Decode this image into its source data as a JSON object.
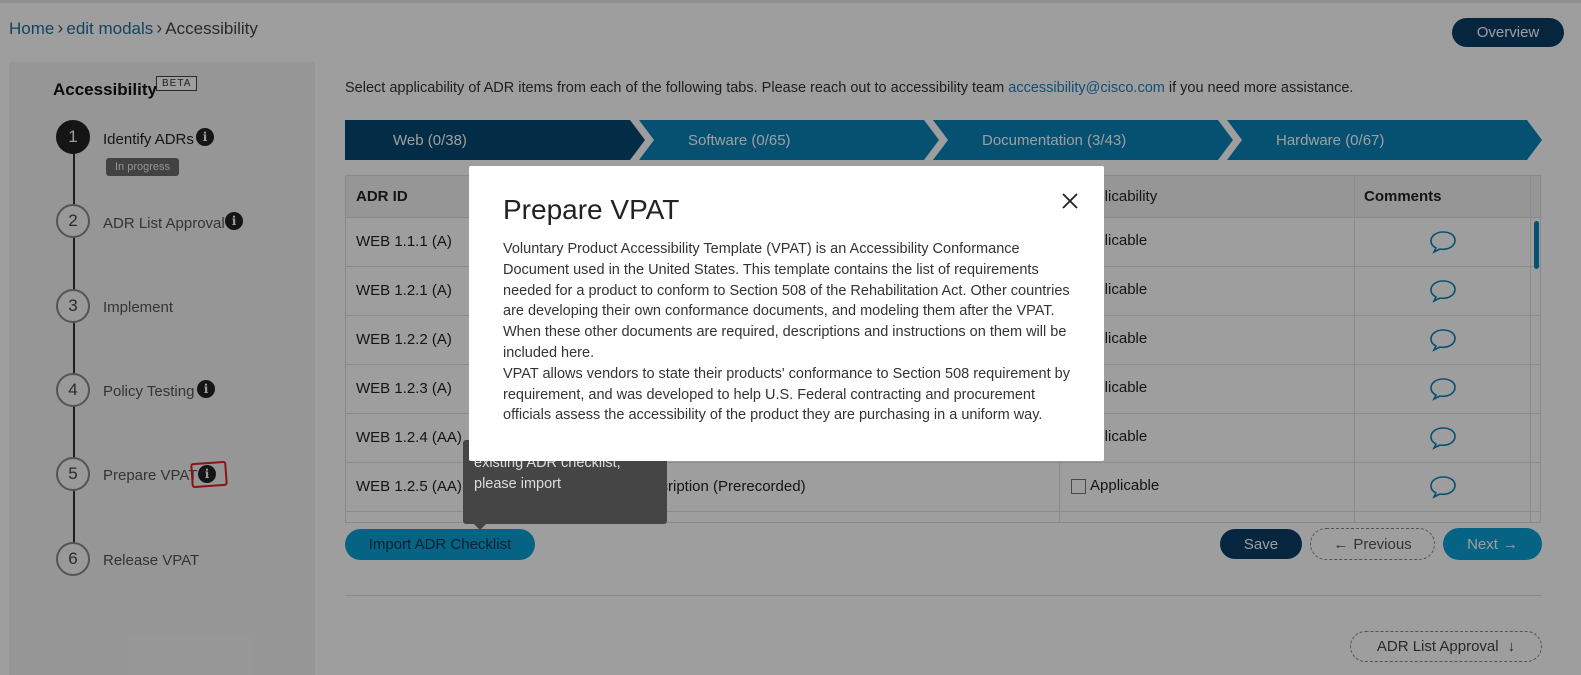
{
  "breadcrumb": {
    "home": "Home",
    "edit_modals": "edit modals",
    "current": "Accessibility",
    "separator": ">"
  },
  "header": {
    "overview_button": "Overview"
  },
  "sidebar": {
    "title": "Accessibility",
    "beta": "BETA",
    "steps": [
      {
        "number": "1",
        "label": "Identify ADRs",
        "status": "In progress"
      },
      {
        "number": "2",
        "label": "ADR List Approval"
      },
      {
        "number": "3",
        "label": "Implement"
      },
      {
        "number": "4",
        "label": "Policy Testing"
      },
      {
        "number": "5",
        "label": "Prepare VPAT"
      },
      {
        "number": "6",
        "label": "Release VPAT"
      }
    ],
    "info_icon": "i"
  },
  "main": {
    "instruction_text": "Select applicability of ADR items from each of the following tabs. Please reach out to accessibility team ",
    "instruction_email": "accessibility@cisco.com",
    "instruction_suffix": " if you need more assistance.",
    "tabs": [
      {
        "label": "Web (0/38)"
      },
      {
        "label": "Software (0/65)"
      },
      {
        "label": "Documentation (3/43)"
      },
      {
        "label": "Hardware (0/67)"
      }
    ],
    "table": {
      "columns": [
        "ADR ID",
        "Applicability",
        "Comments"
      ],
      "applicability_partial": "pplicability",
      "rows": [
        {
          "id": "WEB 1.1.1 (A)",
          "applicability_partial": "pplicable"
        },
        {
          "id": "WEB 1.2.1 (A)",
          "applicability_partial": "pplicable"
        },
        {
          "id": "WEB 1.2.2 (A)",
          "applicability_partial": "pplicable"
        },
        {
          "id": "WEB 1.2.3 (A)",
          "applicability_partial": "pplicable"
        },
        {
          "id": "WEB 1.2.4 (AA)",
          "applicability_partial": "pplicable"
        },
        {
          "id": "WEB 1.2.5 (AA)",
          "description_partial": "io Description (Prerecorded)",
          "applicability": "Applicable"
        }
      ]
    },
    "buttons": {
      "import": "Import ADR Checklist",
      "save": "Save",
      "previous": "Previous",
      "next": "Next",
      "adr_list_approval": "ADR List Approval"
    }
  },
  "tooltip": {
    "text": "If you want to use an existing ADR checklist, please import"
  },
  "modal": {
    "title": "Prepare VPAT",
    "paragraph1": "Voluntary Product Accessibility Template (VPAT) is an Accessibility Conformance Document used in the United States. This template contains the list of requirements needed for a product to conform to Section 508 of the Rehabilitation Act. Other countries are developing their own conformance documents, and modeling them after the VPAT. When these other documents are required, descriptions and instructions on them will be included here.",
    "paragraph2": "VPAT allows vendors to state their products' conformance to Section 508 requirement by requirement, and was developed to help U.S. Federal contracting and procurement officials assess the accessibility of the product they are purchasing in a uniform way."
  },
  "colors": {
    "navy": "#0b3d67",
    "accent": "#0a82b8",
    "cyan": "#0aa0d6",
    "annotation": "#e02020"
  },
  "icons": [
    "chevron-right-icon",
    "info-icon",
    "comment-icon",
    "checkbox-icon",
    "close-icon",
    "arrow-left-icon",
    "arrow-right-icon",
    "arrow-down-icon"
  ]
}
